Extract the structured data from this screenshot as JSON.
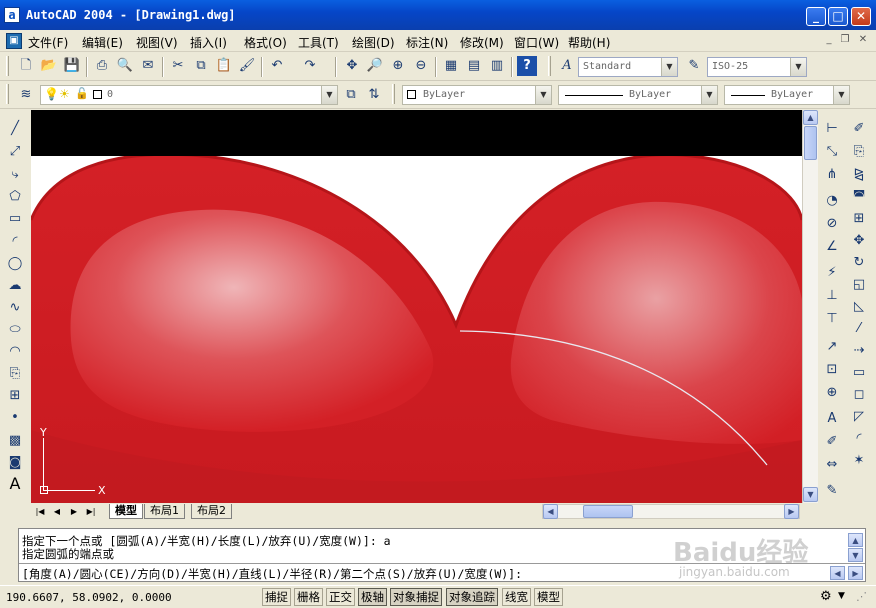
{
  "window": {
    "app_icon": "a",
    "title": "AutoCAD 2004 - [Drawing1.dwg]",
    "minimize": "_",
    "maximize": "□",
    "close": "✕"
  },
  "menu": {
    "items": [
      "文件(F)",
      "编辑(E)",
      "视图(V)",
      "插入(I)",
      "格式(O)",
      "工具(T)",
      "绘图(D)",
      "标注(N)",
      "修改(M)",
      "窗口(W)",
      "帮助(H)"
    ]
  },
  "toolbar": {
    "text_style": "Standard",
    "dim_style": "ISO-25",
    "layer": "0",
    "color": "ByLayer",
    "linetype": "ByLayer",
    "lineweight": "ByLayer"
  },
  "tabs": {
    "items": [
      "模型",
      "布局1",
      "布局2"
    ],
    "active": "模型"
  },
  "ucs": {
    "x_label": "X",
    "y_label": "Y"
  },
  "command": {
    "line1": "指定下一个点或 [圆弧(A)/半宽(H)/长度(L)/放弃(U)/宽度(W)]: a",
    "line2": "指定圆弧的端点或",
    "line3": "[角度(A)/圆心(CE)/方向(D)/半宽(H)/直线(L)/半径(R)/第二个点(S)/放弃(U)/宽度(W)]:"
  },
  "status": {
    "coords": "190.6607, 58.0902, 0.0000",
    "toggles": [
      "捕捉",
      "栅格",
      "正交",
      "极轴",
      "对象捕捉",
      "对象追踪",
      "线宽",
      "模型"
    ]
  },
  "watermark": {
    "main": "Baidu经验",
    "sub": "jingyan.baidu.com"
  },
  "colors": {
    "heart_red": "#d42026",
    "heart_dark": "#b01418",
    "titlebar": "#0a50d8"
  }
}
